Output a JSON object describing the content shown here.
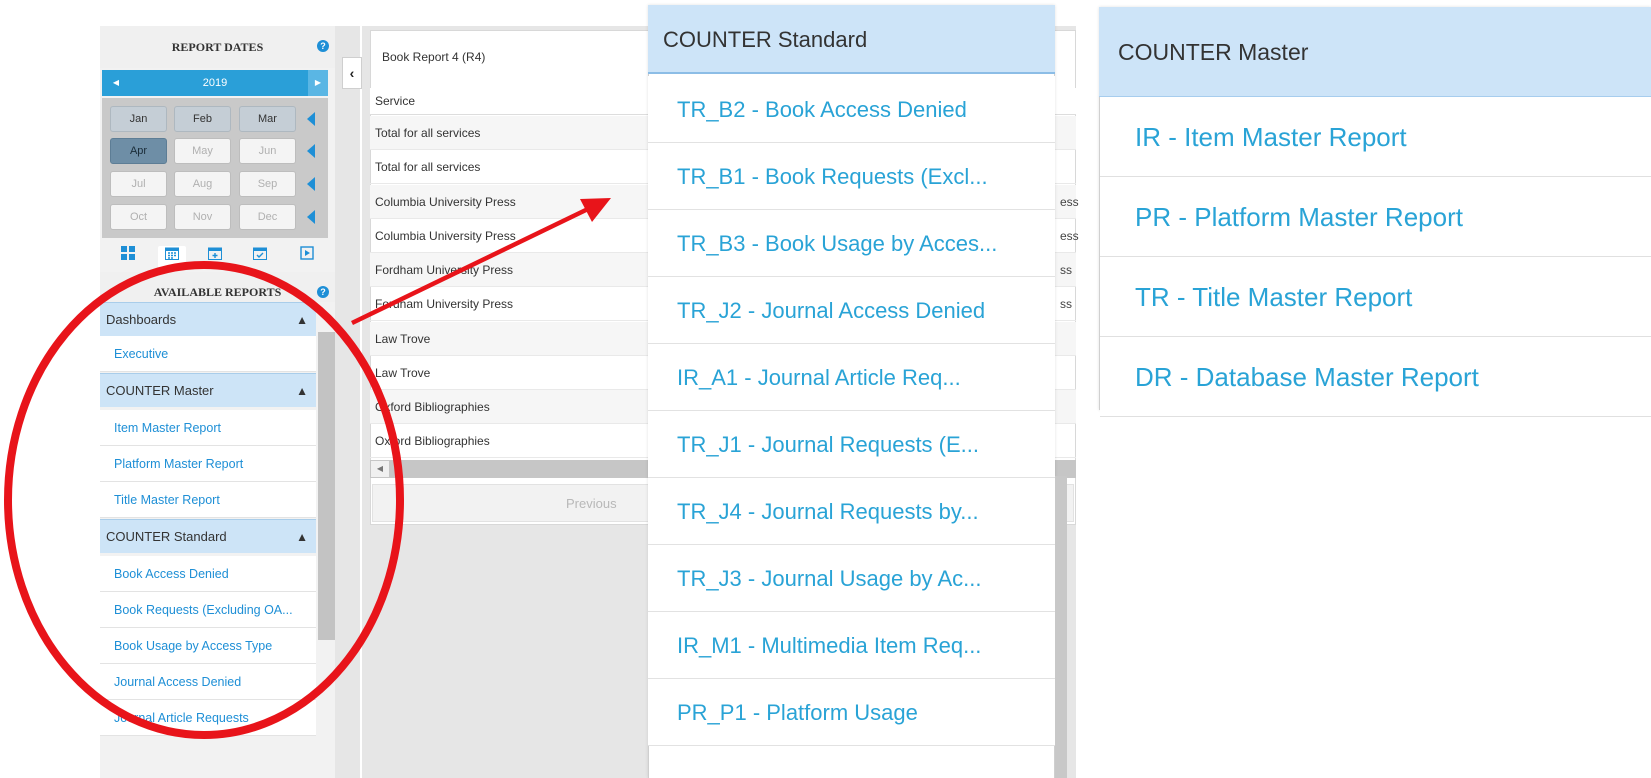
{
  "sidebar": {
    "report_dates_title": "REPORT DATES",
    "help_glyph": "?",
    "year": "2019",
    "prev_year_icon": "caret-left-icon",
    "next_year_icon": "caret-right-icon",
    "months": [
      {
        "label": "Jan",
        "state": "available"
      },
      {
        "label": "Feb",
        "state": "available"
      },
      {
        "label": "Mar",
        "state": "available"
      },
      {
        "label": "Apr",
        "state": "selected"
      },
      {
        "label": "May",
        "state": "disabled"
      },
      {
        "label": "Jun",
        "state": "disabled"
      },
      {
        "label": "Jul",
        "state": "disabled"
      },
      {
        "label": "Aug",
        "state": "disabled"
      },
      {
        "label": "Sep",
        "state": "disabled"
      },
      {
        "label": "Oct",
        "state": "disabled"
      },
      {
        "label": "Nov",
        "state": "disabled"
      },
      {
        "label": "Dec",
        "state": "disabled"
      }
    ],
    "view_icons": [
      "grid-icon",
      "calendar-icon",
      "calendar-plus-icon",
      "calendar-check-icon",
      "play-icon"
    ],
    "available_reports_title": "AVAILABLE REPORTS",
    "groups": {
      "dashboards": {
        "label": "Dashboards",
        "items": [
          "Executive"
        ]
      },
      "counter_master": {
        "label": "COUNTER Master",
        "items": [
          "Item Master Report",
          "Platform Master Report",
          "Title Master Report"
        ]
      },
      "counter_standard": {
        "label": "COUNTER Standard",
        "items": [
          "Book Access Denied",
          "Book Requests (Excluding OA...",
          "Book Usage by Access Type",
          "Journal Access Denied",
          "Journal Article Requests"
        ]
      }
    }
  },
  "main": {
    "report_title": "Book Report 4 (R4)",
    "column_header": "Service",
    "rows": [
      {
        "service": "Total for all services",
        "right": ""
      },
      {
        "service": "Total for all services",
        "right": ""
      },
      {
        "service": "Columbia University Press",
        "right": "ess"
      },
      {
        "service": "Columbia University Press",
        "right": "ess"
      },
      {
        "service": "Fordham University Press",
        "right": "ss"
      },
      {
        "service": "Fordham University Press",
        "right": "ss"
      },
      {
        "service": "Law Trove",
        "right": ""
      },
      {
        "service": "Law Trove",
        "right": ""
      },
      {
        "service": "Oxford Bibliographies",
        "right": ""
      },
      {
        "service": "Oxford Bibliographies",
        "right": ""
      }
    ],
    "pager_prev": "Previous"
  },
  "counter_standard_panel": {
    "title": "COUNTER Standard",
    "items": [
      "TR_B2 - Book Access Denied",
      "TR_B1 - Book Requests (Excl...",
      "TR_B3 - Book Usage by Acces...",
      "TR_J2 - Journal Access Denied",
      "IR_A1 - Journal Article Req...",
      "TR_J1 - Journal Requests (E...",
      "TR_J4 - Journal Requests by...",
      "TR_J3 - Journal Usage by Ac...",
      "IR_M1 - Multimedia Item Req...",
      "PR_P1 - Platform Usage"
    ]
  },
  "counter_master_panel": {
    "title": "COUNTER Master",
    "items": [
      "IR - Item Master Report",
      "PR - Platform Master Report",
      "TR - Title Master Report",
      "DR - Database Master Report"
    ]
  },
  "colors": {
    "accent": "#1e8fd6",
    "link": "#29a3d6",
    "group_header_bg": "#cde4f8",
    "annotation": "#e8141a"
  }
}
